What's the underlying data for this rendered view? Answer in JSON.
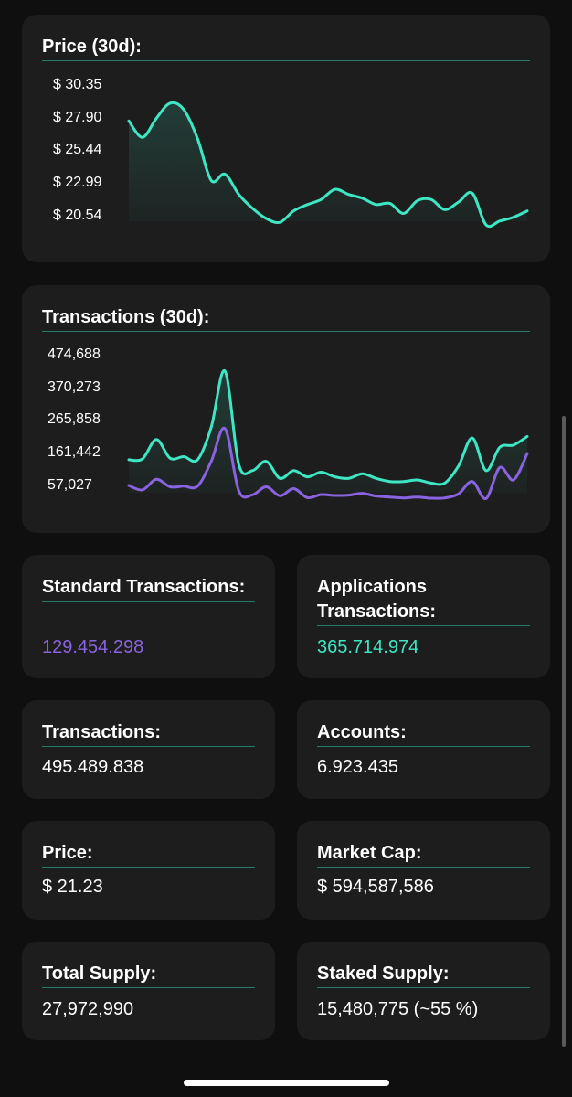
{
  "colors": {
    "teal": "#3ee6c4",
    "purple": "#8a63e0",
    "card": "#1d1d1d",
    "underline": "#2a7a6c"
  },
  "price_chart": {
    "title": "Price (30d):",
    "ticks": [
      "$ 30.35",
      "$ 27.90",
      "$ 25.44",
      "$ 22.99",
      "$ 20.54"
    ],
    "chart_data": {
      "type": "area",
      "title": "Price (30d):",
      "ylim": [
        20.54,
        30.35
      ],
      "y_ticks": [
        30.35,
        27.9,
        25.44,
        22.99,
        20.54
      ],
      "series": [
        {
          "color": "#3ee6c4",
          "values": [
            28.6,
            27.3,
            28.8,
            30.0,
            29.5,
            27.2,
            23.9,
            24.4,
            22.8,
            21.7,
            20.9,
            20.6,
            21.5,
            22.0,
            22.4,
            23.2,
            22.8,
            22.5,
            22.0,
            22.1,
            21.3,
            22.3,
            22.4,
            21.6,
            22.2,
            22.9,
            20.4,
            20.7,
            21.0,
            21.5
          ]
        }
      ]
    }
  },
  "tx_chart": {
    "title": "Transactions (30d):",
    "ticks": [
      "474,688",
      "370,273",
      "265,858",
      "161,442",
      "57,027"
    ],
    "chart_data": {
      "type": "area",
      "title": "Transactions (30d):",
      "ylim": [
        57027,
        474688
      ],
      "y_ticks": [
        474688,
        370273,
        265858,
        161442,
        57027
      ],
      "series": [
        {
          "color": "#3ee6c4",
          "values": [
            175000,
            178000,
            240000,
            180000,
            185000,
            175000,
            280000,
            460000,
            160000,
            140000,
            170000,
            115000,
            140000,
            120000,
            135000,
            120000,
            115000,
            130000,
            115000,
            105000,
            105000,
            110000,
            100000,
            100000,
            155000,
            245000,
            140000,
            215000,
            222000,
            250000
          ]
        },
        {
          "color": "#8a63e0",
          "values": [
            92000,
            78000,
            112000,
            88000,
            90000,
            90000,
            170000,
            275000,
            75000,
            62000,
            88000,
            59000,
            82000,
            53000,
            63000,
            60000,
            61000,
            67000,
            58000,
            55000,
            52000,
            55000,
            51000,
            52000,
            65000,
            105000,
            50000,
            150000,
            110000,
            195000
          ]
        }
      ]
    }
  },
  "stats": {
    "standard": {
      "title": "Standard Transactions:",
      "value": "129.454.298",
      "value_color": "#8a63e0"
    },
    "applications": {
      "title": "Applications Transactions:",
      "value": "365.714.974",
      "value_color": "#3ee6c4"
    },
    "transactions": {
      "title": "Transactions:",
      "value": "495.489.838"
    },
    "accounts": {
      "title": "Accounts:",
      "value": "6.923.435"
    },
    "price": {
      "title": "Price:",
      "value": "$ 21.23"
    },
    "market_cap": {
      "title": "Market Cap:",
      "value": "$ 594,587,586"
    },
    "total_supply": {
      "title": "Total Supply:",
      "value": "27,972,990"
    },
    "staked_supply": {
      "title": "Staked Supply:",
      "value": "15,480,775 (~55 %)"
    }
  }
}
